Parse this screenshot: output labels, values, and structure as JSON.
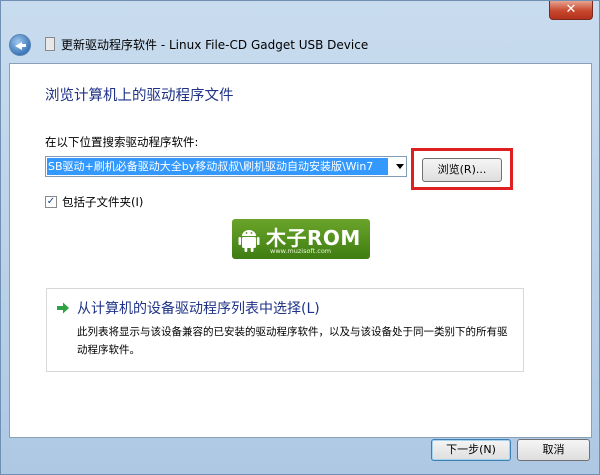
{
  "window": {
    "title": "更新驱动程序软件 - Linux File-CD Gadget USB Device",
    "close_label": "✕"
  },
  "main": {
    "heading": "浏览计算机上的驱动程序文件",
    "search_label": "在以下位置搜索驱动程序软件:",
    "path_value": "SB驱动+刷机必备驱动大全by移动叔叔\\刷机驱动自动安装版\\Win7",
    "browse_label": "浏览(R)...",
    "include_subfolders_label": "包括子文件夹(I)",
    "include_subfolders_checked": true
  },
  "watermark": {
    "brand": "木子ROM",
    "url": "www.muzisoft.com"
  },
  "option": {
    "title": "从计算机的设备驱动程序列表中选择(L)",
    "description": "此列表将显示与该设备兼容的已安装的驱动程序软件，以及与该设备处于同一类别下的所有驱动程序软件。"
  },
  "footer": {
    "next_label": "下一步(N)",
    "cancel_label": "取消"
  },
  "colors": {
    "heading": "#1e3287",
    "selection": "#3399ff",
    "highlight": "#e02020",
    "option_arrow": "#2fa043"
  }
}
